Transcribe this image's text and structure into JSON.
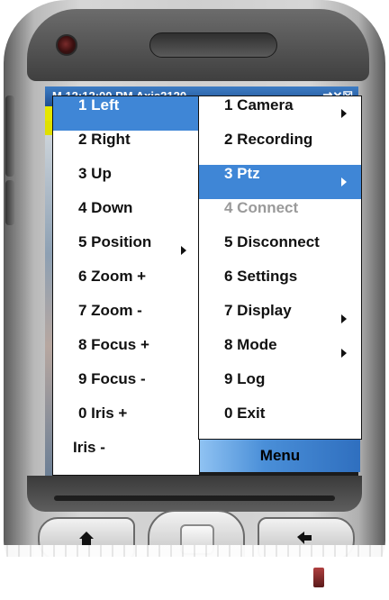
{
  "status_bar": {
    "text": "M 12:12:00 PM Axis2120",
    "icons": "⇄✕☒"
  },
  "submenu": {
    "name": "ptz-submenu",
    "items": [
      {
        "label": "1 Left",
        "selected": true
      },
      {
        "label": "2 Right"
      },
      {
        "label": "3 Up"
      },
      {
        "label": "4 Down"
      },
      {
        "label": "5 Position",
        "has_submenu": true
      },
      {
        "label": "6 Zoom +"
      },
      {
        "label": "7 Zoom -"
      },
      {
        "label": "8 Focus +"
      },
      {
        "label": "9 Focus -"
      },
      {
        "label": "0 Iris +"
      },
      {
        "label": "Iris -"
      }
    ]
  },
  "main_menu": {
    "items": [
      {
        "label": "1 Camera",
        "has_submenu": true
      },
      {
        "label": "2 Recording"
      },
      {
        "label": "3 Ptz",
        "has_submenu": true,
        "selected": true
      },
      {
        "label": "4 Connect",
        "disabled": true
      },
      {
        "label": "5 Disconnect"
      },
      {
        "label": "6 Settings"
      },
      {
        "label": "7 Display",
        "has_submenu": true
      },
      {
        "label": "8 Mode",
        "has_submenu": true
      },
      {
        "label": "9 Log"
      },
      {
        "label": "0 Exit"
      }
    ]
  },
  "softkey": {
    "label": "Menu"
  },
  "hardware_buttons": {
    "left": "home-icon",
    "right": "back-icon"
  },
  "colors": {
    "selection": "#3f86d6",
    "status_bar": "#1f4f91",
    "disabled_text": "#9a9a9a"
  }
}
